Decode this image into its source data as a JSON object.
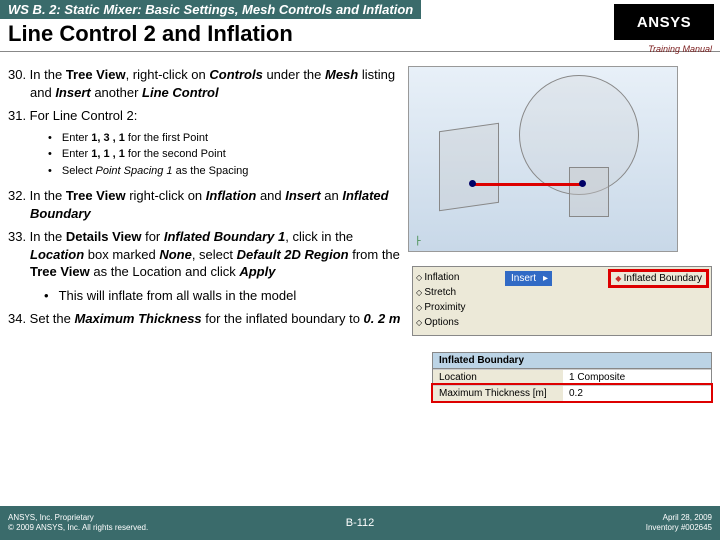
{
  "header": {
    "breadcrumb": "WS B. 2: Static Mixer: Basic Settings, Mesh Controls and Inflation",
    "title": "Line Control 2 and Inflation",
    "logo_text": "ANSYS",
    "training_manual": "Training Manual"
  },
  "steps": {
    "s30_pre": "30. In the ",
    "s30_tree": "Tree View",
    "s30_mid1": ", right-click on ",
    "s30_controls": "Controls",
    "s30_mid2": " under the ",
    "s30_mesh": "Mesh",
    "s30_mid3": " listing and ",
    "s30_insert": "Insert",
    "s30_mid4": " another ",
    "s30_lc": "Line Control",
    "s31": "31. For Line Control 2:",
    "b1_a": "Enter ",
    "b1_b": "1, 3 , 1",
    "b1_c": " for the first Point",
    "b2_a": "Enter ",
    "b2_b": "1, 1 , 1",
    "b2_c": " for the second Point",
    "b3_a": "Select ",
    "b3_b": "Point Spacing 1",
    "b3_c": " as the Spacing",
    "s32_pre": "32. In the ",
    "s32_tree": "Tree View",
    "s32_mid1": " right-click on ",
    "s32_infl": "Inflation",
    "s32_mid2": " and ",
    "s32_insert": "Insert",
    "s32_mid3": " an ",
    "s32_ib": "Inflated Boundary",
    "s33_pre": "33. In the ",
    "s33_dv": "Details View",
    "s33_mid1": " for ",
    "s33_ib1": "Inflated Boundary 1",
    "s33_mid2": ", click in the ",
    "s33_loc": "Location",
    "s33_mid3": " box marked ",
    "s33_none": "None",
    "s33_mid4": ", select ",
    "s33_d2d": "Default 2D Region",
    "s33_mid5": " from the ",
    "s33_tree": "Tree View",
    "s33_mid6": " as the Location and click ",
    "s33_apply": "Apply",
    "sub2": "This will inflate from all walls in the model",
    "s34_pre": "34. Set the ",
    "s34_mt": "Maximum Thickness",
    "s34_mid": " for the inflated boundary to ",
    "s34_val": "0. 2 m"
  },
  "tree": {
    "inflation": "Inflation",
    "stretch": "Stretch",
    "proximity": "Proximity",
    "options": "Options"
  },
  "menu": {
    "insert": "Insert",
    "inflated_boundary": "Inflated Boundary"
  },
  "details": {
    "title": "Inflated Boundary",
    "row1_label": "Location",
    "row1_value": "1 Composite",
    "row2_label": "Maximum Thickness [m]",
    "row2_value": "0.2"
  },
  "footer": {
    "proprietary_l1": "ANSYS, Inc. Proprietary",
    "proprietary_l2": "© 2009 ANSYS, Inc. All rights reserved.",
    "page": "B-112",
    "date": "April 28, 2009",
    "inventory": "Inventory #002645"
  }
}
